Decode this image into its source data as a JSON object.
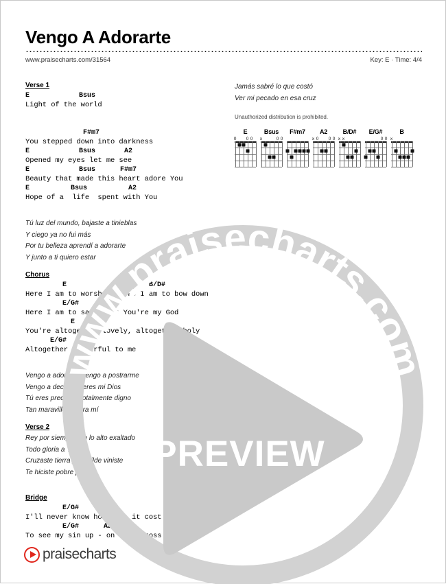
{
  "document": {
    "title": "Vengo A Adorarte",
    "url": "www.praisecharts.com/31564",
    "key_time": "Key: E · Time: 4/4",
    "notice": "Unauthorized distribution is prohibited."
  },
  "watermark": {
    "ring_text": "www.praisecharts.com",
    "preview_label": "PREVIEW",
    "ring_color": "#d2d2d2",
    "triangle_color": "#c9c9c9"
  },
  "footer": {
    "brand": "praisecharts",
    "accent_color": "#e0251b"
  },
  "left_column": {
    "sections": [
      {
        "heading": "Verse 1",
        "lines": [
          {
            "chords": "E            Bsus",
            "lyrics": "Light of the world"
          },
          {
            "chords": "",
            "lyrics": ""
          },
          {
            "chords": "              F#m7",
            "lyrics": "You stepped down into darkness"
          },
          {
            "chords": "E            Bsus       A2",
            "lyrics": "Opened my eyes let me see"
          },
          {
            "chords": "E            Bsus      F#m7",
            "lyrics": "Beauty that made this heart adore You"
          },
          {
            "chords": "E          Bsus          A2",
            "lyrics": "Hope of a  life  spent with You"
          }
        ]
      }
    ],
    "verse1_translation": [
      "Tú luz del mundo, bajaste a tinieblas",
      "Y ciego ya no fui más",
      "Por tu belleza aprendí a adorarte",
      "Y junto a ti quiero estar"
    ],
    "chorus": {
      "heading": "Chorus",
      "lines": [
        {
          "chords": "         E                    B/D#",
          "lyrics": "Here I am to worship, here I am to bow down"
        },
        {
          "chords": "         E/G#",
          "lyrics": "Here I am to say  that You're my God"
        },
        {
          "chords": "           E",
          "lyrics": "You're altogether lovely, altogether holy"
        },
        {
          "chords": "      E/G#",
          "lyrics": "Altogether wonderful to me"
        }
      ]
    },
    "chorus_translation": [
      "Vengo a adorarte, vengo a postrarme",
      "Vengo a decir que eres mi Dios",
      "Tú eres precioso, totalmente digno",
      "Tan maravilloso para mí"
    ],
    "verse2": {
      "heading": "Verse 2",
      "lines": [
        "Rey por siempre, en lo alto exaltado",
        "Todo gloria a Ti",
        "Cruzaste tierra y humilde viniste",
        "Te hiciste pobre por mí"
      ]
    },
    "bridge": {
      "heading": "Bridge",
      "lines": [
        {
          "chords": "         E/G#      A2",
          "lyrics": "I'll never know how much it cost"
        },
        {
          "chords": "         E/G#      A2",
          "lyrics": "To see my sin up - on that cross"
        }
      ]
    }
  },
  "right_column": {
    "translation": [
      "Jamás sabré lo que costó",
      "Ver mi pecado en esa cruz"
    ]
  },
  "chord_diagrams": [
    {
      "name": "E",
      "markers": [
        "0",
        "",
        "",
        "0",
        "0",
        ""
      ],
      "dots": [
        [
          2,
          1
        ],
        [
          3,
          1
        ],
        [
          4,
          2
        ]
      ]
    },
    {
      "name": "Bsus",
      "markers": [
        "x",
        "",
        "",
        "",
        "0",
        "0"
      ],
      "dots": [
        [
          2,
          1
        ],
        [
          3,
          3
        ],
        [
          4,
          3
        ]
      ]
    },
    {
      "name": "F#m7",
      "markers": [
        "",
        "",
        "",
        "",
        "",
        ""
      ],
      "dots": [
        [
          1,
          2
        ],
        [
          3,
          2
        ],
        [
          4,
          2
        ],
        [
          5,
          2
        ],
        [
          6,
          2
        ],
        [
          2,
          3
        ]
      ]
    },
    {
      "name": "A2",
      "markers": [
        "x",
        "0",
        "",
        "",
        "0",
        "0"
      ],
      "dots": [
        [
          3,
          2
        ],
        [
          4,
          2
        ]
      ]
    },
    {
      "name": "B/D#",
      "markers": [
        "x",
        "x",
        "",
        "",
        "",
        ""
      ],
      "dots": [
        [
          2,
          1
        ],
        [
          5,
          2
        ],
        [
          3,
          3
        ],
        [
          4,
          3
        ]
      ]
    },
    {
      "name": "E/G#",
      "markers": [
        "",
        "",
        "",
        "",
        "0",
        "0"
      ],
      "dots": [
        [
          2,
          2
        ],
        [
          3,
          2
        ],
        [
          1,
          3
        ],
        [
          4,
          3
        ]
      ]
    },
    {
      "name": "B",
      "markers": [
        "x",
        "",
        "",
        "",
        "",
        ""
      ],
      "dots": [
        [
          2,
          2
        ],
        [
          6,
          2
        ],
        [
          3,
          3
        ],
        [
          4,
          3
        ],
        [
          5,
          3
        ]
      ]
    }
  ]
}
